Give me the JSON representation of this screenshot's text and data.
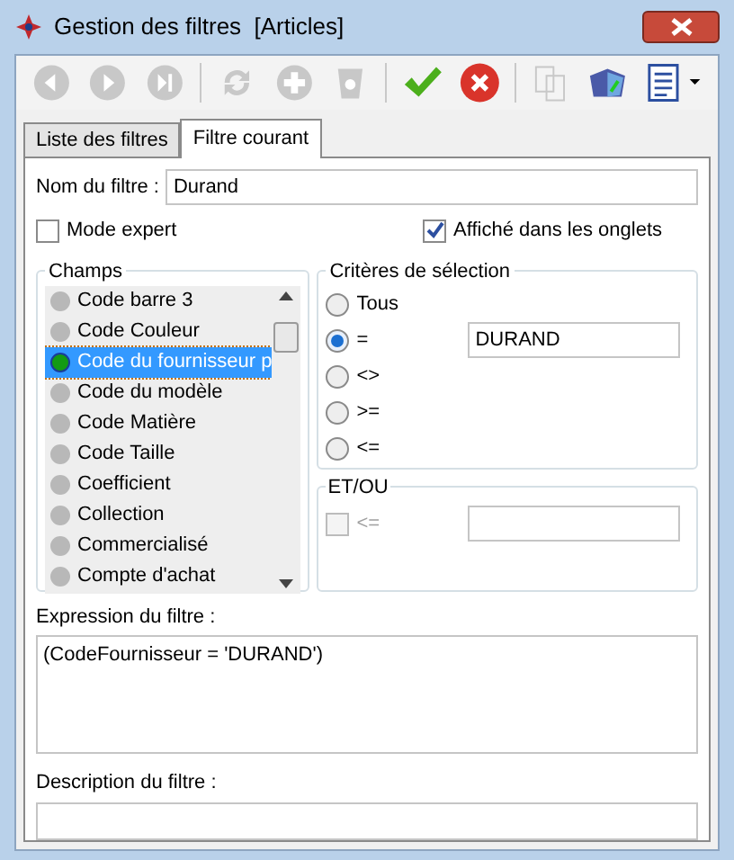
{
  "window": {
    "title": "Gestion des filtres  [Articles]"
  },
  "toolbar": [
    {
      "kind": "first",
      "disabled": true
    },
    {
      "kind": "play",
      "disabled": true
    },
    {
      "kind": "last",
      "disabled": true
    },
    {
      "kind": "sep"
    },
    {
      "kind": "refresh",
      "disabled": true
    },
    {
      "kind": "add",
      "disabled": true
    },
    {
      "kind": "delete",
      "disabled": true
    },
    {
      "kind": "sep"
    },
    {
      "kind": "validate",
      "disabled": false
    },
    {
      "kind": "cancel",
      "disabled": false
    },
    {
      "kind": "sep"
    },
    {
      "kind": "copy",
      "disabled": true
    },
    {
      "kind": "cube",
      "disabled": false
    },
    {
      "kind": "list",
      "disabled": false
    }
  ],
  "tabs": [
    {
      "label": "Liste des filtres",
      "selected": false
    },
    {
      "label": "Filtre courant",
      "selected": true
    }
  ],
  "name_field": {
    "label": "Nom du filtre :",
    "value": "Durand"
  },
  "expert_mode": {
    "label": "Mode expert",
    "checked": false
  },
  "shown_in_tabs": {
    "label": "Affiché dans les onglets",
    "checked": true
  },
  "fields": {
    "title": "Champs",
    "items": [
      {
        "label": "Code barre 3",
        "selected": false
      },
      {
        "label": "Code Couleur",
        "selected": false
      },
      {
        "label": "Code du fournisseur p",
        "selected": true
      },
      {
        "label": "Code du modèle",
        "selected": false
      },
      {
        "label": "Code Matière",
        "selected": false
      },
      {
        "label": "Code Taille",
        "selected": false
      },
      {
        "label": "Coefficient",
        "selected": false
      },
      {
        "label": "Collection",
        "selected": false
      },
      {
        "label": "Commercialisé",
        "selected": false
      },
      {
        "label": "Compte d'achat",
        "selected": false
      }
    ]
  },
  "criteria": {
    "title": "Critères de sélection",
    "options": [
      {
        "label": "Tous",
        "selected": false
      },
      {
        "label": "=",
        "selected": true,
        "value": "DURAND"
      },
      {
        "label": "<>",
        "selected": false
      },
      {
        "label": ">=",
        "selected": false
      },
      {
        "label": "<=",
        "selected": false
      }
    ]
  },
  "and_or": {
    "title": "ET/OU",
    "label": "<=",
    "checked": false,
    "disabled": true
  },
  "expression": {
    "label": "Expression du filtre :",
    "value": "(CodeFournisseur = 'DURAND')"
  },
  "description": {
    "label": "Description du filtre :"
  }
}
